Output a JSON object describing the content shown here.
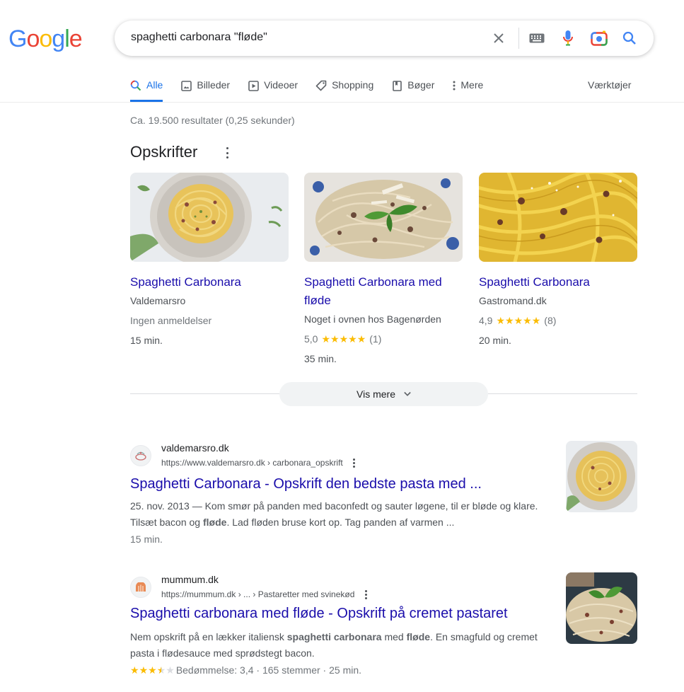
{
  "logo": {
    "letters": [
      "G",
      "o",
      "o",
      "g",
      "l",
      "e"
    ],
    "colors": [
      "#4285f4",
      "#ea4335",
      "#fbbc05",
      "#4285f4",
      "#34a853",
      "#ea4335"
    ]
  },
  "search": {
    "query": "spaghetti carbonara \"fløde\""
  },
  "tabs": [
    {
      "label": "Alle",
      "icon": "search-icon",
      "active": true
    },
    {
      "label": "Billeder",
      "icon": "image-icon"
    },
    {
      "label": "Videoer",
      "icon": "video-icon"
    },
    {
      "label": "Shopping",
      "icon": "tag-icon"
    },
    {
      "label": "Bøger",
      "icon": "book-icon"
    },
    {
      "label": "Mere",
      "icon": "more-vert-icon"
    }
  ],
  "tools_label": "Værktøjer",
  "result_stats": "Ca. 19.500 resultater (0,25 sekunder)",
  "recipes": {
    "title": "Opskrifter",
    "cards": [
      {
        "title": "Spaghetti Carbonara",
        "source": "Valdemarsro",
        "rating_text": "Ingen anmeldelser",
        "time": "15 min."
      },
      {
        "title": "Spaghetti Carbonara med fløde",
        "source": "Noget i ovnen hos Bagenørden",
        "rating": "5,0",
        "stars": 5,
        "count": "(1)",
        "time": "35 min."
      },
      {
        "title": "Spaghetti Carbonara",
        "source": "Gastromand.dk",
        "rating": "4,9",
        "stars": 5,
        "count": "(8)",
        "time": "20 min."
      }
    ],
    "more_label": "Vis mere"
  },
  "results": [
    {
      "site": "valdemarsro.dk",
      "url": "https://www.valdemarsro.dk › carbonara_opskrift",
      "title": "Spaghetti Carbonara - Opskrift den bedste pasta med ...",
      "snippet_date": "25. nov. 2013 — ",
      "snippet_a": "Kom smør på panden med baconfedt og sauter løgene, til er bløde og klare. Tilsæt bacon og ",
      "snippet_bold": "fløde",
      "snippet_b": ". Lad fløden bruse kort op. Tag panden af varmen ...",
      "time": "15 min."
    },
    {
      "site": "mummum.dk",
      "url": "https://mummum.dk › ... › Pastaretter med svinekød",
      "title": "Spaghetti carbonara med fløde - Opskrift på cremet pastaret",
      "snippet_a": "Nem opskrift på en lækker italiensk ",
      "snippet_bold1": "spaghetti carbonara",
      "snippet_mid": " med ",
      "snippet_bold2": "fløde",
      "snippet_b": ". En smagfuld og cremet pasta i flødesauce med sprødstegt bacon.",
      "rating_text": "Bedømmelse: 3,4 · 165 stemmer · 25 min.",
      "rating_value": 3.4
    }
  ],
  "colors": {
    "link": "#1a0dab",
    "accent": "#1a73e8",
    "star": "#fbbc04"
  }
}
